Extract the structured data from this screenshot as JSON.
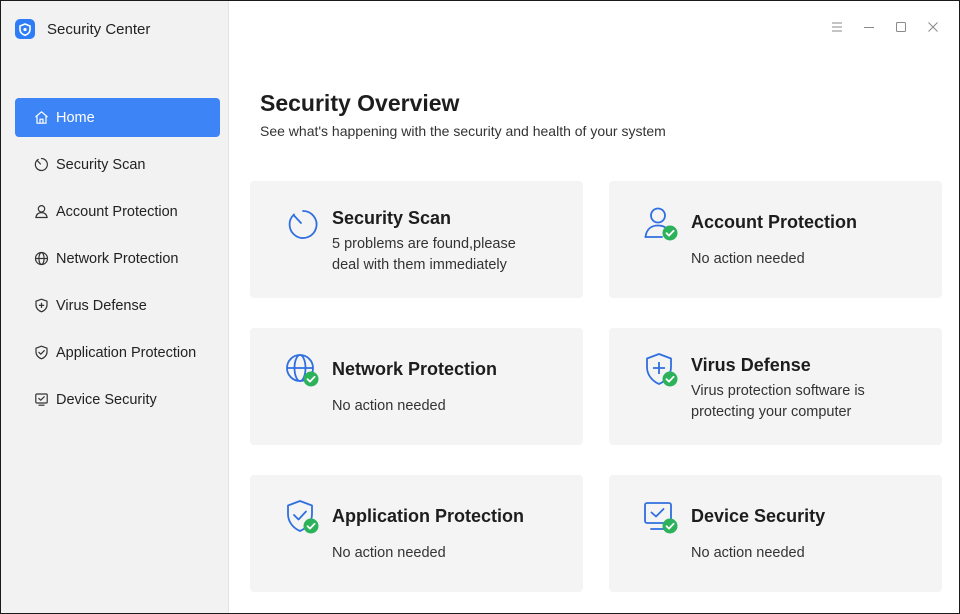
{
  "app": {
    "title": "Security Center"
  },
  "window_controls": {
    "menu": "menu-icon",
    "minimize": "minimize-icon",
    "maximize": "maximize-icon",
    "close": "close-icon"
  },
  "sidebar": {
    "items": [
      {
        "label": "Home",
        "icon": "home-icon",
        "active": true
      },
      {
        "label": "Security Scan",
        "icon": "scan-icon",
        "active": false
      },
      {
        "label": "Account Protection",
        "icon": "user-icon",
        "active": false
      },
      {
        "label": "Network Protection",
        "icon": "globe-icon",
        "active": false
      },
      {
        "label": "Virus Defense",
        "icon": "shield-plus-icon",
        "active": false
      },
      {
        "label": "Application Protection",
        "icon": "shield-check-icon",
        "active": false
      },
      {
        "label": "Device Security",
        "icon": "monitor-check-icon",
        "active": false
      }
    ]
  },
  "main": {
    "title": "Security Overview",
    "subtitle": "See what's happening with the security and health of your system",
    "cards": [
      {
        "title": "Security Scan",
        "desc_line1": "5 problems are found,please",
        "desc_line2": "deal with them immediately",
        "icon": "scan-icon"
      },
      {
        "title": "Account Protection",
        "desc_line1": "No action needed",
        "icon": "user-check-icon"
      },
      {
        "title": "Network Protection",
        "desc_line1": "No action needed",
        "icon": "globe-check-icon"
      },
      {
        "title": "Virus Defense",
        "desc_line1": "Virus protection software is",
        "desc_line2": "protecting your computer",
        "icon": "shield-plus-check-icon"
      },
      {
        "title": "Application Protection",
        "desc_line1": "No action needed",
        "icon": "shield-check-icon"
      },
      {
        "title": "Device Security",
        "desc_line1": "No action needed",
        "icon": "monitor-check-icon"
      }
    ]
  },
  "colors": {
    "accent": "#3d84f7",
    "icon_blue": "#2f6fe0",
    "ok_green": "#2cb25b",
    "sidebar_bg": "#f2f2f2",
    "card_bg": "#f4f4f4"
  }
}
